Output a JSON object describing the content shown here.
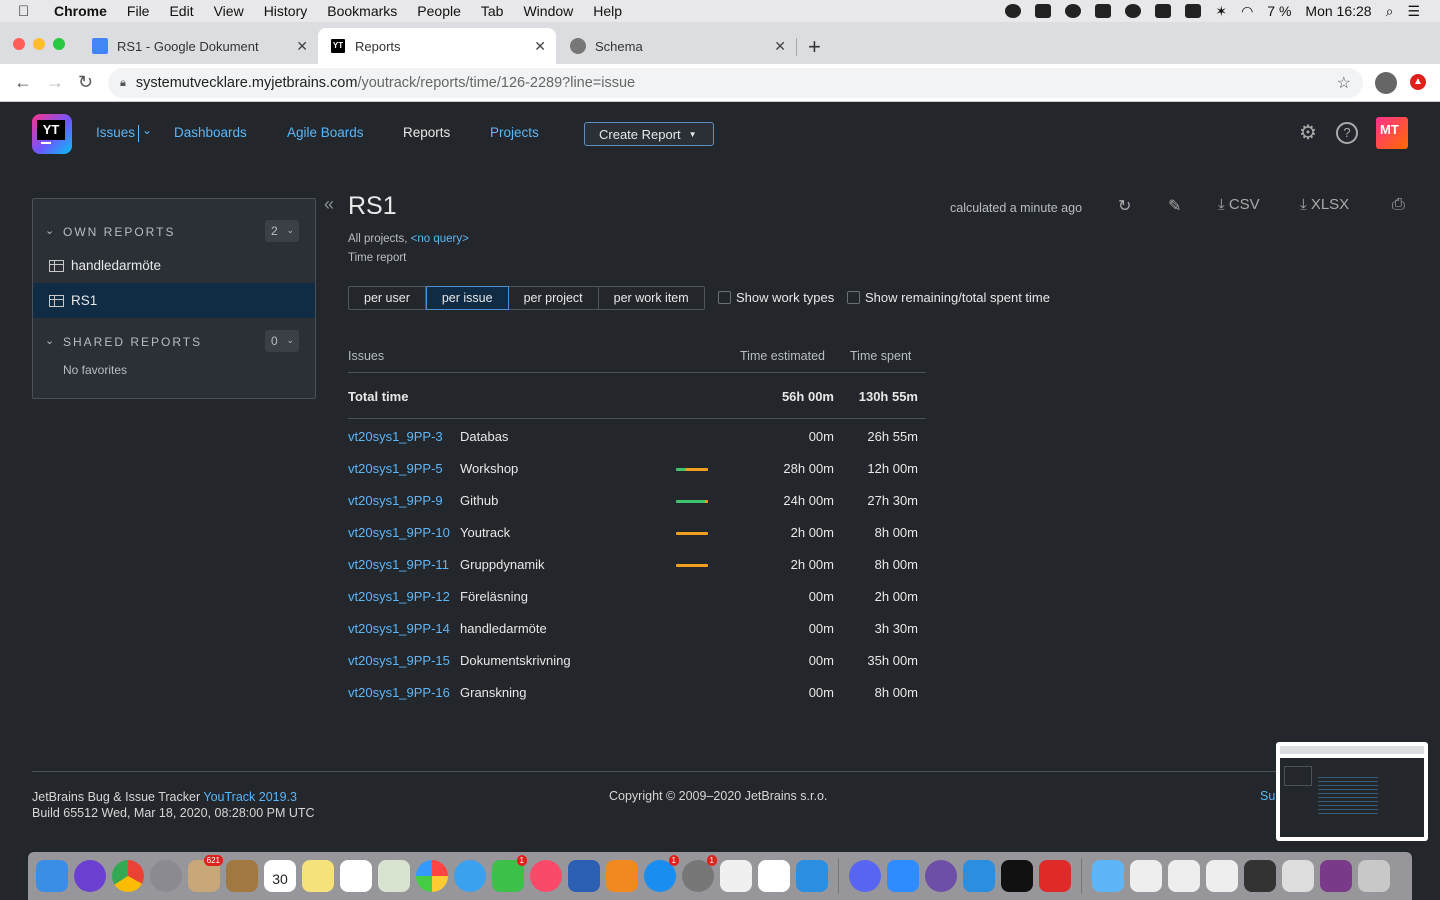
{
  "menubar": {
    "app": "Chrome",
    "items": [
      "File",
      "Edit",
      "View",
      "History",
      "Bookmarks",
      "People",
      "Tab",
      "Window",
      "Help"
    ],
    "battery": "7 %",
    "clock": "Mon 16:28"
  },
  "browser": {
    "tabs": [
      {
        "title": "RS1 - Google Dokument",
        "icon": "docs-icon",
        "color": "#4285f4"
      },
      {
        "title": "Reports",
        "icon": "youtrack-icon",
        "color": "#000000"
      },
      {
        "title": "Schema",
        "icon": "globe-icon",
        "color": "#666666"
      }
    ],
    "url_host": "systemutvecklare.myjetbrains.com",
    "url_path": "/youtrack/reports/time/126-2289?line=issue"
  },
  "header": {
    "logo": "YT",
    "nav": {
      "issues": "Issues",
      "dashboards": "Dashboards",
      "agile": "Agile Boards",
      "reports": "Reports",
      "projects": "Projects"
    },
    "create_report": "Create Report",
    "avatar": "MT"
  },
  "sidebar": {
    "own_label": "OWN REPORTS",
    "own_count": "2",
    "own_items": [
      "handledarmöte",
      "RS1"
    ],
    "shared_label": "SHARED REPORTS",
    "shared_count": "0",
    "shared_empty": "No favorites"
  },
  "report": {
    "title": "RS1",
    "calculated": "calculated a minute ago",
    "csv": "CSV",
    "xlsx": "XLSX",
    "projects_text": "All projects,",
    "query": "<no query>",
    "type": "Time report",
    "grouping": [
      "per user",
      "per issue",
      "per project",
      "per work item"
    ],
    "active_grouping": "per issue",
    "show_work_types": "Show work types",
    "show_remaining": "Show remaining/total spent time",
    "columns": {
      "issues": "Issues",
      "estimated": "Time estimated",
      "spent": "Time spent"
    },
    "total": {
      "label": "Total time",
      "estimated": "56h 00m",
      "spent": "130h 55m"
    },
    "rows": [
      {
        "id": "vt20sys1_9PP-3",
        "summary": "Databas",
        "estimated": "00m",
        "spent": "26h 55m",
        "bar": ""
      },
      {
        "id": "vt20sys1_9PP-5",
        "summary": "Workshop",
        "estimated": "28h 00m",
        "spent": "12h 00m",
        "bar": "mixed"
      },
      {
        "id": "vt20sys1_9PP-9",
        "summary": "Github",
        "estimated": "24h 00m",
        "spent": "27h 30m",
        "bar": "green"
      },
      {
        "id": "vt20sys1_9PP-10",
        "summary": "Youtrack",
        "estimated": "2h 00m",
        "spent": "8h 00m",
        "bar": "orange"
      },
      {
        "id": "vt20sys1_9PP-11",
        "summary": "Gruppdynamik",
        "estimated": "2h 00m",
        "spent": "8h 00m",
        "bar": "orange"
      },
      {
        "id": "vt20sys1_9PP-12",
        "summary": "Föreläsning",
        "estimated": "00m",
        "spent": "2h 00m",
        "bar": ""
      },
      {
        "id": "vt20sys1_9PP-14",
        "summary": "handledarmöte",
        "estimated": "00m",
        "spent": "3h 30m",
        "bar": ""
      },
      {
        "id": "vt20sys1_9PP-15",
        "summary": "Dokumentskrivning",
        "estimated": "00m",
        "spent": "35h 00m",
        "bar": ""
      },
      {
        "id": "vt20sys1_9PP-16",
        "summary": "Granskning",
        "estimated": "00m",
        "spent": "8h 00m",
        "bar": ""
      }
    ]
  },
  "footer": {
    "tracker": "JetBrains Bug & Issue Tracker",
    "version": "YouTrack 2019.3",
    "build": "Build 65512 Wed, Mar 18, 2020, 08:28:00 PM UTC",
    "copyright": "Copyright © 2009–2020 JetBrains s.r.o.",
    "right_link": "Su"
  },
  "colors": {
    "accent": "#5cb6f8",
    "bar_green": "#3ec46d",
    "bar_orange": "#f0a020",
    "selected_bg": "#102b44"
  },
  "dock": {
    "badges": {
      "mail": "621",
      "calendar": "30",
      "messages": "1",
      "appstore": "1",
      "prefs": "1"
    }
  }
}
